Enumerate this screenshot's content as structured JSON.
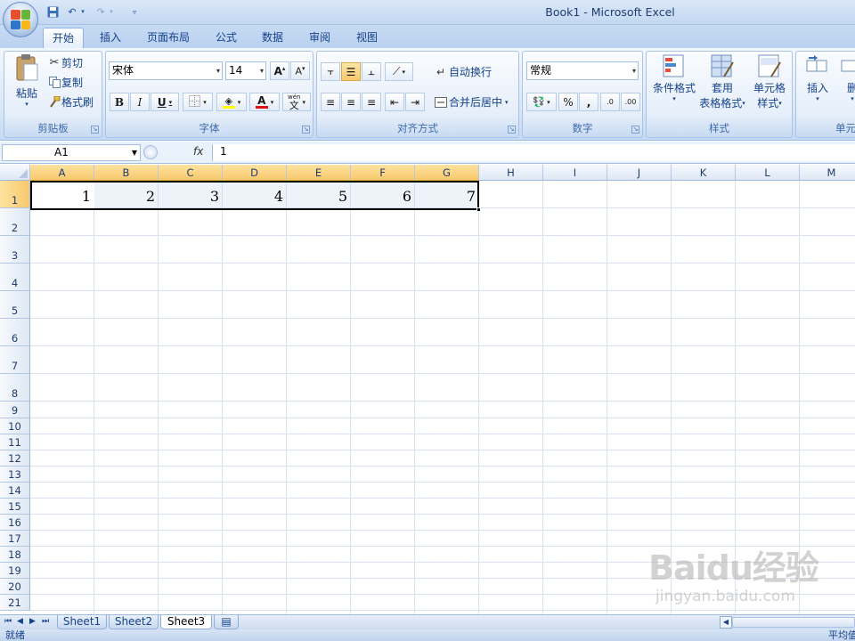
{
  "window": {
    "title": "Book1 - Microsoft Excel"
  },
  "tabs": [
    {
      "label": "开始"
    },
    {
      "label": "插入"
    },
    {
      "label": "页面布局"
    },
    {
      "label": "公式"
    },
    {
      "label": "数据"
    },
    {
      "label": "审阅"
    },
    {
      "label": "视图"
    }
  ],
  "clipboard": {
    "paste": "粘贴",
    "cut": "剪切",
    "copy": "复制",
    "format_painter": "格式刷",
    "label": "剪贴板"
  },
  "font": {
    "name": "宋体",
    "size": "14",
    "label": "字体",
    "bold": "B",
    "italic": "I",
    "underline": "U",
    "font_color": "A",
    "wen": "wén"
  },
  "alignment": {
    "wrap": "自动换行",
    "merge": "合并后居中",
    "label": "对齐方式"
  },
  "number": {
    "format": "常规",
    "percent": "%",
    "comma": ",",
    "inc": ".00",
    "dec": ".0",
    "label": "数字"
  },
  "styles": {
    "conditional": "条件格式",
    "table1": "套用",
    "table2": "表格格式",
    "cell1": "单元格",
    "cell2": "样式",
    "label": "样式"
  },
  "cells": {
    "insert": "插入",
    "delete": "删",
    "label": "单元"
  },
  "formula_bar": {
    "name_box": "A1",
    "fx": "fx",
    "value": "1"
  },
  "columns": [
    "A",
    "B",
    "C",
    "D",
    "E",
    "F",
    "G",
    "H",
    "I",
    "J",
    "K",
    "L",
    "M"
  ],
  "rows": [
    "1",
    "2",
    "3",
    "4",
    "5",
    "6",
    "7",
    "8",
    "9",
    "10",
    "11",
    "12",
    "13",
    "14",
    "15",
    "16",
    "17",
    "18",
    "19",
    "20",
    "21"
  ],
  "row1_values": [
    "1",
    "2",
    "3",
    "4",
    "5",
    "6",
    "7"
  ],
  "sheets": [
    {
      "label": "Sheet1"
    },
    {
      "label": "Sheet2"
    },
    {
      "label": "Sheet3"
    }
  ],
  "status": {
    "left": "就绪",
    "right": "平均值"
  },
  "watermark": {
    "brand": "Baidu经验",
    "url": "jingyan.baidu.com"
  }
}
